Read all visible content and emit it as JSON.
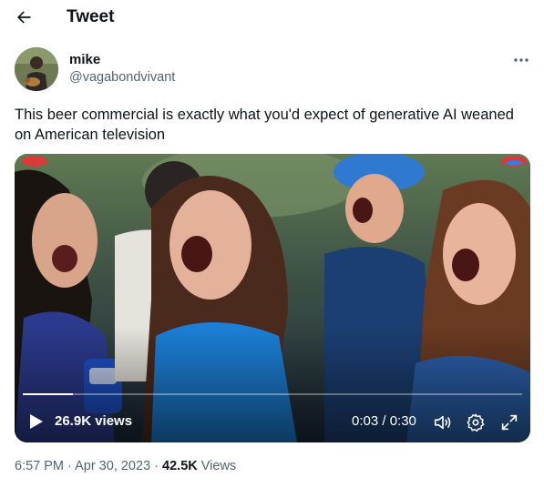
{
  "header": {
    "title": "Tweet"
  },
  "author": {
    "name": "mike",
    "handle": "@vagabondvivant"
  },
  "tweet": {
    "text": "This beer commercial is exactly what you'd expect of generative AI weaned on American television"
  },
  "video": {
    "views": "26.9K views",
    "time": "0:03 / 0:30",
    "progress_fraction": 0.1,
    "controls": [
      "play-icon",
      "volume-icon",
      "settings-icon",
      "fullscreen-icon"
    ]
  },
  "meta": {
    "time": "6:57 PM",
    "sep1": " · ",
    "date": "Apr 30, 2023",
    "sep2": " · ",
    "views_count": "42.5K",
    "views_label": " Views"
  },
  "colors": {
    "text_primary": "#0f1419",
    "text_secondary": "#536471"
  }
}
